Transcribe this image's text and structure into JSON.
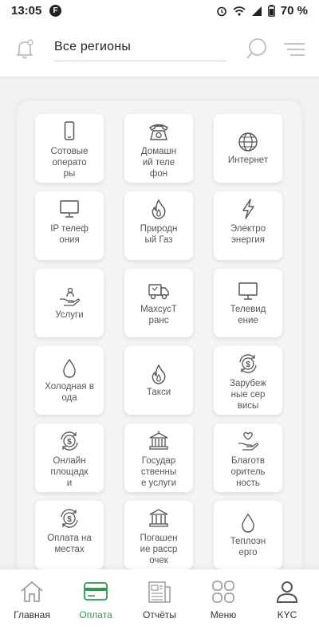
{
  "status_bar": {
    "time": "13:05",
    "app_badge": "F",
    "battery_percent": "70 %"
  },
  "header": {
    "region_value": "Все регионы",
    "icons": [
      "bell-icon",
      "search-icon",
      "menu-icon"
    ]
  },
  "tiles": [
    {
      "label": "Сотовые операторы",
      "icon": "mobile-phone-icon"
    },
    {
      "label": "Домашний телефон",
      "icon": "landline-phone-icon"
    },
    {
      "label": "Интернет",
      "icon": "globe-icon"
    },
    {
      "label": "IP телефония",
      "icon": "monitor-icon"
    },
    {
      "label": "Природный Газ",
      "icon": "flame-icon"
    },
    {
      "label": "Электроэнергия",
      "icon": "lightning-icon"
    },
    {
      "label": "Услуги",
      "icon": "hand-person-icon"
    },
    {
      "label": "МахсусТранс",
      "icon": "truck-icon"
    },
    {
      "label": "Телевидение",
      "icon": "tv-icon"
    },
    {
      "label": "Холодная вода",
      "icon": "water-drop-icon"
    },
    {
      "label": "Такси",
      "icon": "flame-icon"
    },
    {
      "label": "Зарубежные сервисы",
      "icon": "dollar-cycle-icon"
    },
    {
      "label": "Онлайн площадки",
      "icon": "dollar-cycle-icon"
    },
    {
      "label": "Государственные услуги",
      "icon": "government-building-icon"
    },
    {
      "label": "Благотворительность",
      "icon": "heart-hand-icon"
    },
    {
      "label": "Оплата на местах",
      "icon": "dollar-cycle-icon"
    },
    {
      "label": "Погашение рассрочек",
      "icon": "bank-icon"
    },
    {
      "label": "Теплоэнерго",
      "icon": "water-drop-icon"
    }
  ],
  "bottom_nav": {
    "items": [
      {
        "label": "Главная",
        "icon": "home-icon"
      },
      {
        "label": "Оплата",
        "icon": "card-icon"
      },
      {
        "label": "Отчёты",
        "icon": "reports-icon"
      },
      {
        "label": "Меню",
        "icon": "grid-icon"
      },
      {
        "label": "KYC",
        "icon": "user-icon"
      }
    ],
    "active_index": 1,
    "active_color": "#2e9a4b"
  }
}
